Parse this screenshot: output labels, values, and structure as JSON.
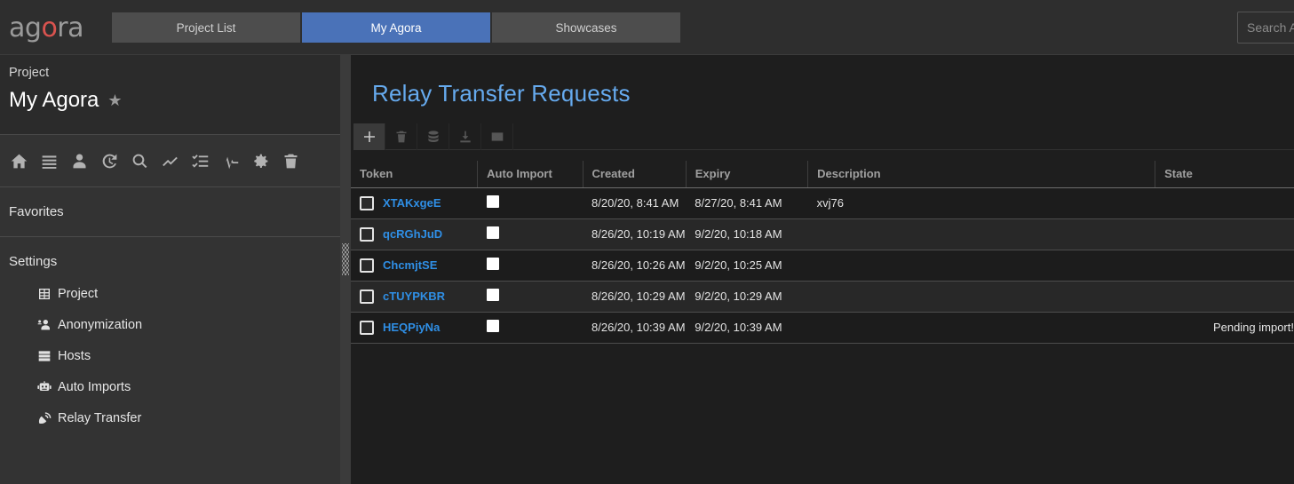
{
  "topbar": {
    "logo_a": "ag",
    "logo_o": "o",
    "logo_ra": "ra",
    "tabs": [
      {
        "label": "Project List",
        "active": false
      },
      {
        "label": "My Agora",
        "active": true
      },
      {
        "label": "Showcases",
        "active": false
      }
    ],
    "search_value": "Search A",
    "search_placeholder": "Search Agora",
    "accent_active_tab": "#4a72b8"
  },
  "sidebar": {
    "project_label": "Project",
    "project_name": "My Agora",
    "favorite_star": "★",
    "quick_icons": [
      "home-icon",
      "list-icon",
      "user-icon",
      "history-icon",
      "search-icon",
      "chart-line-icon",
      "list-check-icon",
      "pulse-icon",
      "gear-icon",
      "trash-icon"
    ],
    "favorites_title": "Favorites",
    "settings_title": "Settings",
    "settings_items": [
      {
        "label": "Project",
        "icon": "table-cells-icon"
      },
      {
        "label": "Anonymization",
        "icon": "user-gear-icon"
      },
      {
        "label": "Hosts",
        "icon": "server-icon"
      },
      {
        "label": "Auto Imports",
        "icon": "robot-icon"
      },
      {
        "label": "Relay Transfer",
        "icon": "satellite-dish-icon"
      }
    ]
  },
  "main": {
    "title": "Relay Transfer Requests",
    "accent_title_color": "#66aaee",
    "toolbar": [
      {
        "name": "add-button",
        "icon": "plus-icon",
        "enabled": true
      },
      {
        "name": "delete-button",
        "icon": "trash-icon",
        "enabled": false
      },
      {
        "name": "database-button",
        "icon": "database-icon",
        "enabled": false
      },
      {
        "name": "download-button",
        "icon": "download-icon",
        "enabled": false
      },
      {
        "name": "email-button",
        "icon": "envelope-icon",
        "enabled": false
      }
    ],
    "table": {
      "columns": [
        "Token",
        "Auto Import",
        "Created",
        "Expiry",
        "Description",
        "State"
      ],
      "rows": [
        {
          "token": "XTAKxgeE",
          "auto_import": true,
          "created": "8/20/20, 8:41 AM",
          "expiry": "8/27/20, 8:41 AM",
          "description": "xvj76",
          "state": "",
          "selected": false
        },
        {
          "token": "qcRGhJuD",
          "auto_import": true,
          "created": "8/26/20, 10:19 AM",
          "expiry": "9/2/20, 10:18 AM",
          "description": "",
          "state": "",
          "selected": false
        },
        {
          "token": "ChcmjtSE",
          "auto_import": true,
          "created": "8/26/20, 10:26 AM",
          "expiry": "9/2/20, 10:25 AM",
          "description": "",
          "state": "",
          "selected": false
        },
        {
          "token": "cTUYPKBR",
          "auto_import": true,
          "created": "8/26/20, 10:29 AM",
          "expiry": "9/2/20, 10:29 AM",
          "description": "",
          "state": "",
          "selected": false
        },
        {
          "token": "HEQPiyNa",
          "auto_import": true,
          "created": "8/26/20, 10:39 AM",
          "expiry": "9/2/20, 10:39 AM",
          "description": "",
          "state": "Pending import!",
          "selected": false
        }
      ]
    }
  }
}
